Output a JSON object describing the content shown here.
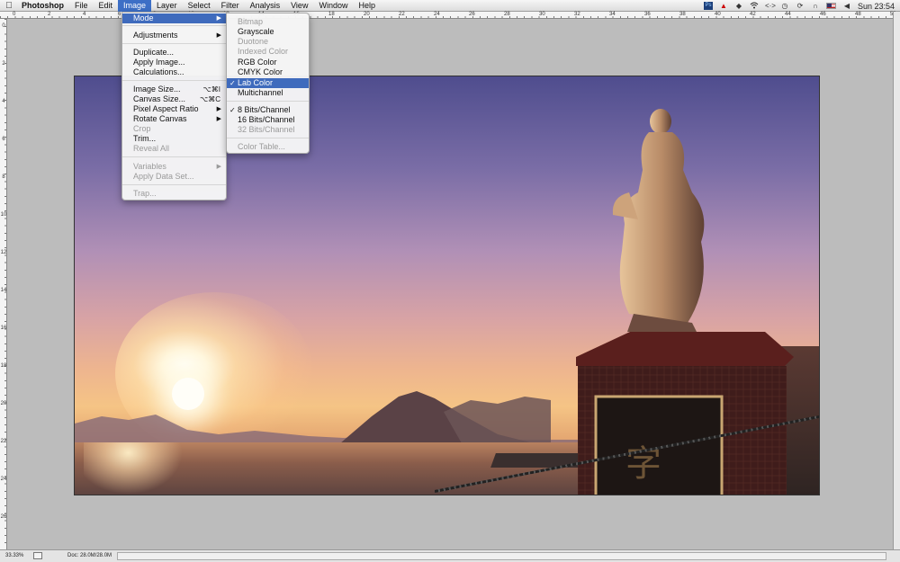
{
  "menubar": {
    "apple_icon": "apple-logo",
    "app_name": "Photoshop",
    "menus": [
      "File",
      "Edit",
      "Image",
      "Layer",
      "Select",
      "Filter",
      "Analysis",
      "View",
      "Window",
      "Help"
    ],
    "open_menu": "Image",
    "status_icons": [
      "ps-icon",
      "adobe-icon",
      "dropbox-icon",
      "wifi-icon",
      "back-forward-icon",
      "clock-icon",
      "sync-icon",
      "headphones-icon",
      "flag-icon",
      "volume-icon"
    ],
    "clock": "Sun 23:54"
  },
  "rulers": {
    "top_labels": [
      "0",
      "2",
      "4",
      "6",
      "8",
      "10",
      "12",
      "14",
      "16",
      "18",
      "20",
      "22",
      "24",
      "26",
      "28",
      "30",
      "32",
      "34",
      "36",
      "38",
      "40",
      "42",
      "44",
      "46",
      "48",
      "50"
    ],
    "left_labels": [
      "0",
      "2",
      "4",
      "6",
      "8",
      "10",
      "12",
      "14",
      "16",
      "18",
      "20",
      "22",
      "24",
      "26"
    ]
  },
  "image_menu": {
    "items": [
      {
        "label": "Mode",
        "arrow": "▶",
        "state": "selected"
      },
      {
        "label": "Adjustments",
        "arrow": "▶"
      },
      {
        "label": "Duplicate..."
      },
      {
        "label": "Apply Image..."
      },
      {
        "label": "Calculations..."
      },
      {
        "label": "Image Size...",
        "shortcut": "⌥⌘I"
      },
      {
        "label": "Canvas Size...",
        "shortcut": "⌥⌘C"
      },
      {
        "label": "Pixel Aspect Ratio",
        "arrow": "▶"
      },
      {
        "label": "Rotate Canvas",
        "arrow": "▶"
      },
      {
        "label": "Crop",
        "state": "disabled"
      },
      {
        "label": "Trim..."
      },
      {
        "label": "Reveal All",
        "state": "disabled"
      },
      {
        "label": "Variables",
        "arrow": "▶",
        "state": "disabled"
      },
      {
        "label": "Apply Data Set...",
        "state": "disabled"
      },
      {
        "label": "Trap...",
        "state": "disabled"
      }
    ]
  },
  "mode_menu": {
    "items": [
      {
        "label": "Bitmap",
        "state": "disabled"
      },
      {
        "label": "Grayscale"
      },
      {
        "label": "Duotone",
        "state": "disabled"
      },
      {
        "label": "Indexed Color",
        "state": "disabled"
      },
      {
        "label": "RGB Color"
      },
      {
        "label": "CMYK Color"
      },
      {
        "label": "Lab Color",
        "check": "✓",
        "state": "selected"
      },
      {
        "label": "Multichannel"
      },
      {
        "label": "8 Bits/Channel",
        "check": "✓"
      },
      {
        "label": "16 Bits/Channel"
      },
      {
        "label": "32 Bits/Channel",
        "state": "disabled"
      },
      {
        "label": "Color Table...",
        "state": "disabled"
      }
    ]
  },
  "statusbar": {
    "zoom": "33.33%",
    "doc_info": "Doc: 28.0M/28.0M"
  },
  "photo": {
    "description_icon": "statue-at-sunset-photo"
  }
}
